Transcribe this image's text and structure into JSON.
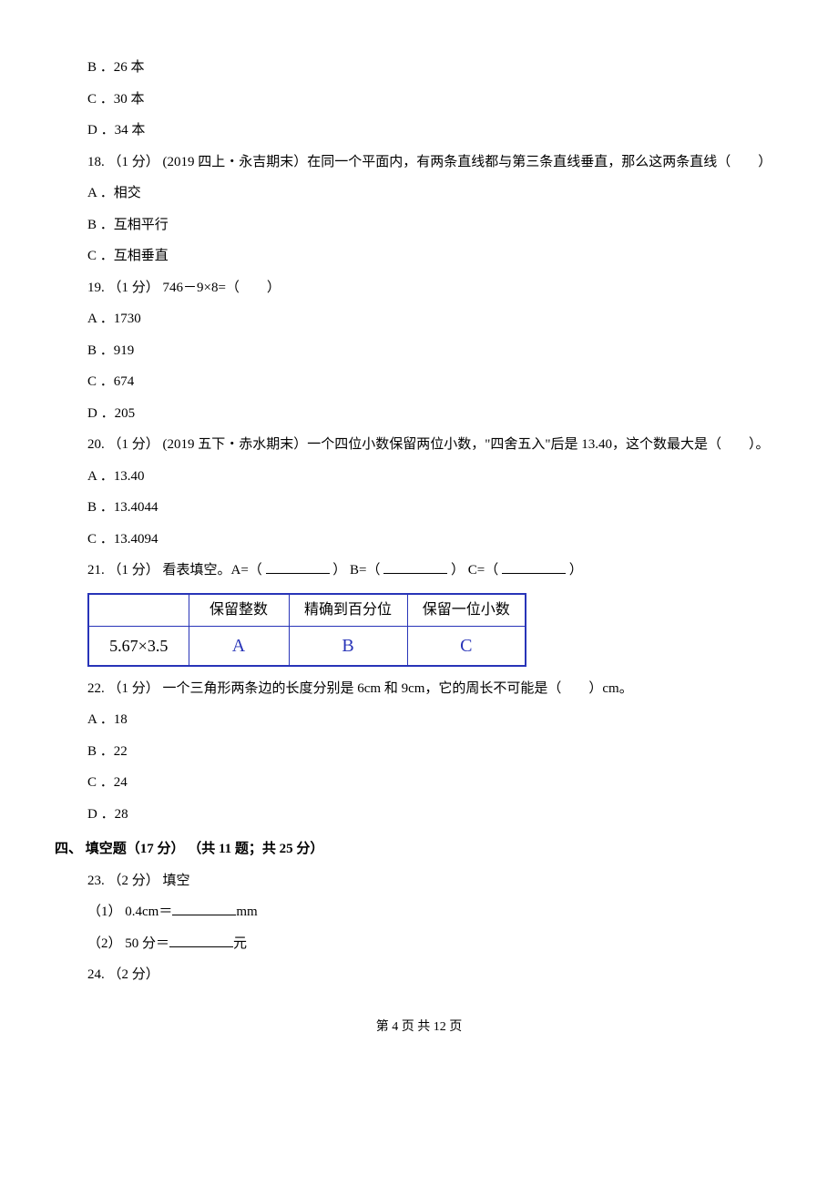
{
  "opts_top": {
    "b": "B ．26 本",
    "c": "C ．30 本",
    "d": "D ．34 本"
  },
  "q18": {
    "stem": "18. （1 分） (2019 四上・永吉期末）在同一个平面内，有两条直线都与第三条直线垂直，那么这两条直线（　　）",
    "a": "A ．相交",
    "b": "B ．互相平行",
    "c": "C ．互相垂直"
  },
  "q19": {
    "stem": "19. （1 分） 746－9×8=（　　）",
    "a": "A ．1730",
    "b": "B ．919",
    "c": "C ．674",
    "d": "D ．205"
  },
  "q20": {
    "stem": "20. （1 分） (2019 五下・赤水期末）一个四位小数保留两位小数，\"四舍五入\"后是 13.40，这个数最大是（　　）。",
    "a": "A ．13.40",
    "b": "B ．13.4044",
    "c": "C ．13.4094"
  },
  "q21": {
    "stem_prefix": "21. （1 分） 看表填空。A=（",
    "mid_b": "）  B=（",
    "mid_c": "）    C=（",
    "stem_suffix": "）",
    "table": {
      "h1": "保留整数",
      "h2": "精确到百分位",
      "h3": "保留一位小数",
      "r_expr": "5.67×3.5",
      "cA": "A",
      "cB": "B",
      "cC": "C"
    }
  },
  "q22": {
    "stem": "22. （1 分） 一个三角形两条边的长度分别是 6cm 和 9cm，它的周长不可能是（　　）cm。",
    "a": "A ．18",
    "b": "B ．22",
    "c": "C ．24",
    "d": "D ．28"
  },
  "section4": "四、 填空题（17 分） （共 11 题；共 25 分）",
  "q23": {
    "stem": "23. （2 分）    填空",
    "p1_pre": "（1） 0.4cm＝",
    "p1_suf": "mm",
    "p2_pre": "（2） 50 分＝",
    "p2_suf": "元"
  },
  "q24": {
    "stem": "24. （2 分）"
  },
  "footer": "第 4 页 共 12 页"
}
